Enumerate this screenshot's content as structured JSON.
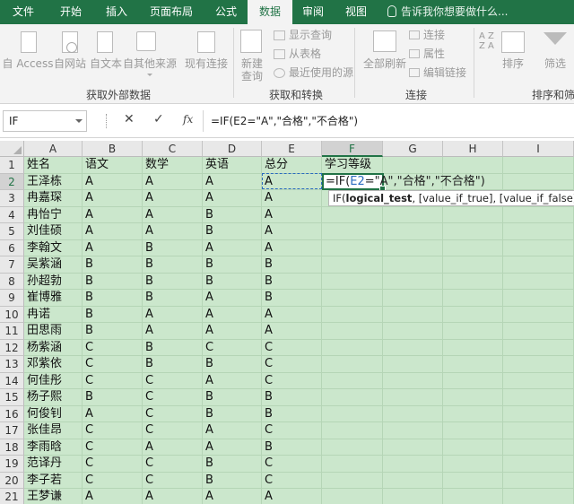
{
  "tabs": [
    "文件",
    "开始",
    "插入",
    "页面布局",
    "公式",
    "数据",
    "审阅",
    "视图"
  ],
  "active_tab": "数据",
  "tell_me": "告诉我你想要做什么...",
  "ribbon": {
    "from_access": "自 Access",
    "from_web": "自网站",
    "from_text": "自文本",
    "from_other": "自其他来源",
    "existing_conn": "现有连接",
    "group_external": "获取外部数据",
    "new_query_1": "新建",
    "new_query_2": "查询",
    "show_queries": "显示查询",
    "from_table": "从表格",
    "recent_sources": "最近使用的源",
    "group_transform": "获取和转换",
    "refresh_all": "全部刷新",
    "connections": "连接",
    "properties": "属性",
    "edit_links": "编辑链接",
    "group_connections": "连接",
    "sort": "排序",
    "filter": "筛选",
    "group_sort": "排序和筛选",
    "az_top": "A Z",
    "az_bottom": "Z A"
  },
  "name_box": "IF",
  "formula": "=IF(E2=\"A\",\"合格\",\"不合格\")",
  "columns": [
    "A",
    "B",
    "C",
    "D",
    "E",
    "F",
    "G",
    "H",
    "I"
  ],
  "selected_column": "F",
  "rows": [
    "1",
    "2",
    "3",
    "4",
    "5",
    "6",
    "7",
    "8",
    "9",
    "10",
    "11",
    "12",
    "13",
    "14",
    "15",
    "16",
    "17",
    "18",
    "19",
    "20",
    "21"
  ],
  "selected_row": "2",
  "headers": [
    "姓名",
    "语文",
    "数学",
    "英语",
    "总分",
    "学习等级"
  ],
  "students": [
    [
      "王泽栋",
      "A",
      "A",
      "A",
      "A"
    ],
    [
      "冉嘉琛",
      "A",
      "A",
      "A",
      "A"
    ],
    [
      "冉怡宁",
      "A",
      "A",
      "B",
      "A"
    ],
    [
      "刘佳硕",
      "A",
      "A",
      "B",
      "A"
    ],
    [
      "李翰文",
      "A",
      "B",
      "A",
      "A"
    ],
    [
      "吴紫涵",
      "B",
      "B",
      "B",
      "B"
    ],
    [
      "孙超勃",
      "B",
      "B",
      "B",
      "B"
    ],
    [
      "崔博雅",
      "B",
      "B",
      "A",
      "B"
    ],
    [
      "冉诺",
      "B",
      "A",
      "A",
      "A"
    ],
    [
      "田思雨",
      "B",
      "A",
      "A",
      "A"
    ],
    [
      "杨紫涵",
      "C",
      "B",
      "C",
      "C"
    ],
    [
      "邓紫依",
      "C",
      "B",
      "B",
      "C"
    ],
    [
      "何佳彤",
      "C",
      "C",
      "A",
      "C"
    ],
    [
      "杨子熙",
      "B",
      "C",
      "B",
      "B"
    ],
    [
      "何俊钊",
      "A",
      "C",
      "B",
      "B"
    ],
    [
      "张佳昂",
      "C",
      "C",
      "A",
      "C"
    ],
    [
      "李雨晗",
      "C",
      "A",
      "A",
      "B"
    ],
    [
      "范译丹",
      "C",
      "C",
      "B",
      "C"
    ],
    [
      "李子若",
      "C",
      "C",
      "B",
      "C"
    ],
    [
      "王梦谦",
      "A",
      "A",
      "A",
      "A"
    ]
  ],
  "edit": {
    "prefix": "=IF(",
    "ref": "E2",
    "suffix": "=\"A\",\"合格\",\"不合格\")"
  },
  "tooltip": {
    "fn": "IF(",
    "arg1": "logical_test",
    "rest": ", [value_if_true], [value_if_false])"
  },
  "colors": {
    "excel_green": "#217346",
    "grid_bg": "#cbe7cc",
    "ref_blue": "#2a6bbf"
  }
}
